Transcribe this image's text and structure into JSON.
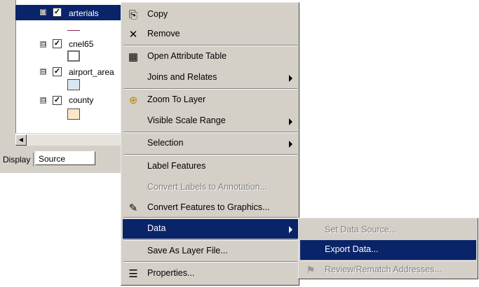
{
  "toc": {
    "layers": [
      {
        "name": "arterials",
        "checked": true,
        "selected": true
      },
      {
        "name": "cnel65",
        "checked": true
      },
      {
        "name": "airport_area",
        "checked": true
      },
      {
        "name": "county",
        "checked": true
      }
    ],
    "expander_glyph": "⊟",
    "check_glyph": "✓",
    "scroll_left_glyph": "◀",
    "tabs": {
      "display": "Display",
      "source": "Source"
    }
  },
  "context_menu": {
    "items": {
      "copy": {
        "label": "Copy",
        "icon": "copy-icon",
        "glyph": "⎘"
      },
      "remove": {
        "label": "Remove",
        "icon": "remove-x-icon",
        "glyph": "✕"
      },
      "open_attribute_table": {
        "label": "Open Attribute Table",
        "icon": "table-icon",
        "glyph": "▦"
      },
      "joins_and_relates": {
        "label": "Joins and Relates"
      },
      "zoom_to_layer": {
        "label": "Zoom To Layer",
        "icon": "zoom-to-layer-icon",
        "glyph": "⊕"
      },
      "visible_scale_range": {
        "label": "Visible Scale Range"
      },
      "selection": {
        "label": "Selection"
      },
      "label_features": {
        "label": "Label Features"
      },
      "convert_labels": {
        "label": "Convert Labels to Annotation...",
        "disabled": true
      },
      "convert_features": {
        "label": "Convert Features to Graphics...",
        "icon": "convert-graphics-icon",
        "glyph": "✎"
      },
      "data": {
        "label": "Data",
        "active": true
      },
      "save_as_layer": {
        "label": "Save As Layer File..."
      },
      "properties": {
        "label": "Properties...",
        "icon": "properties-icon",
        "glyph": "☰"
      }
    }
  },
  "data_submenu": {
    "set_data_source": {
      "label": "Set Data Source...",
      "disabled": true
    },
    "export_data": {
      "label": "Export Data...",
      "active": true
    },
    "review_rematch": {
      "label": "Review/Rematch Addresses...",
      "disabled": true,
      "icon": "geocode-icon",
      "glyph": "⚑"
    }
  },
  "colors": {
    "selection": "#0a246a",
    "menu_bg": "#d4d0c8",
    "cnel65_line": "#8b2252",
    "airport_fill": "#d9e6f0",
    "county_fill": "#fbe6c8"
  }
}
